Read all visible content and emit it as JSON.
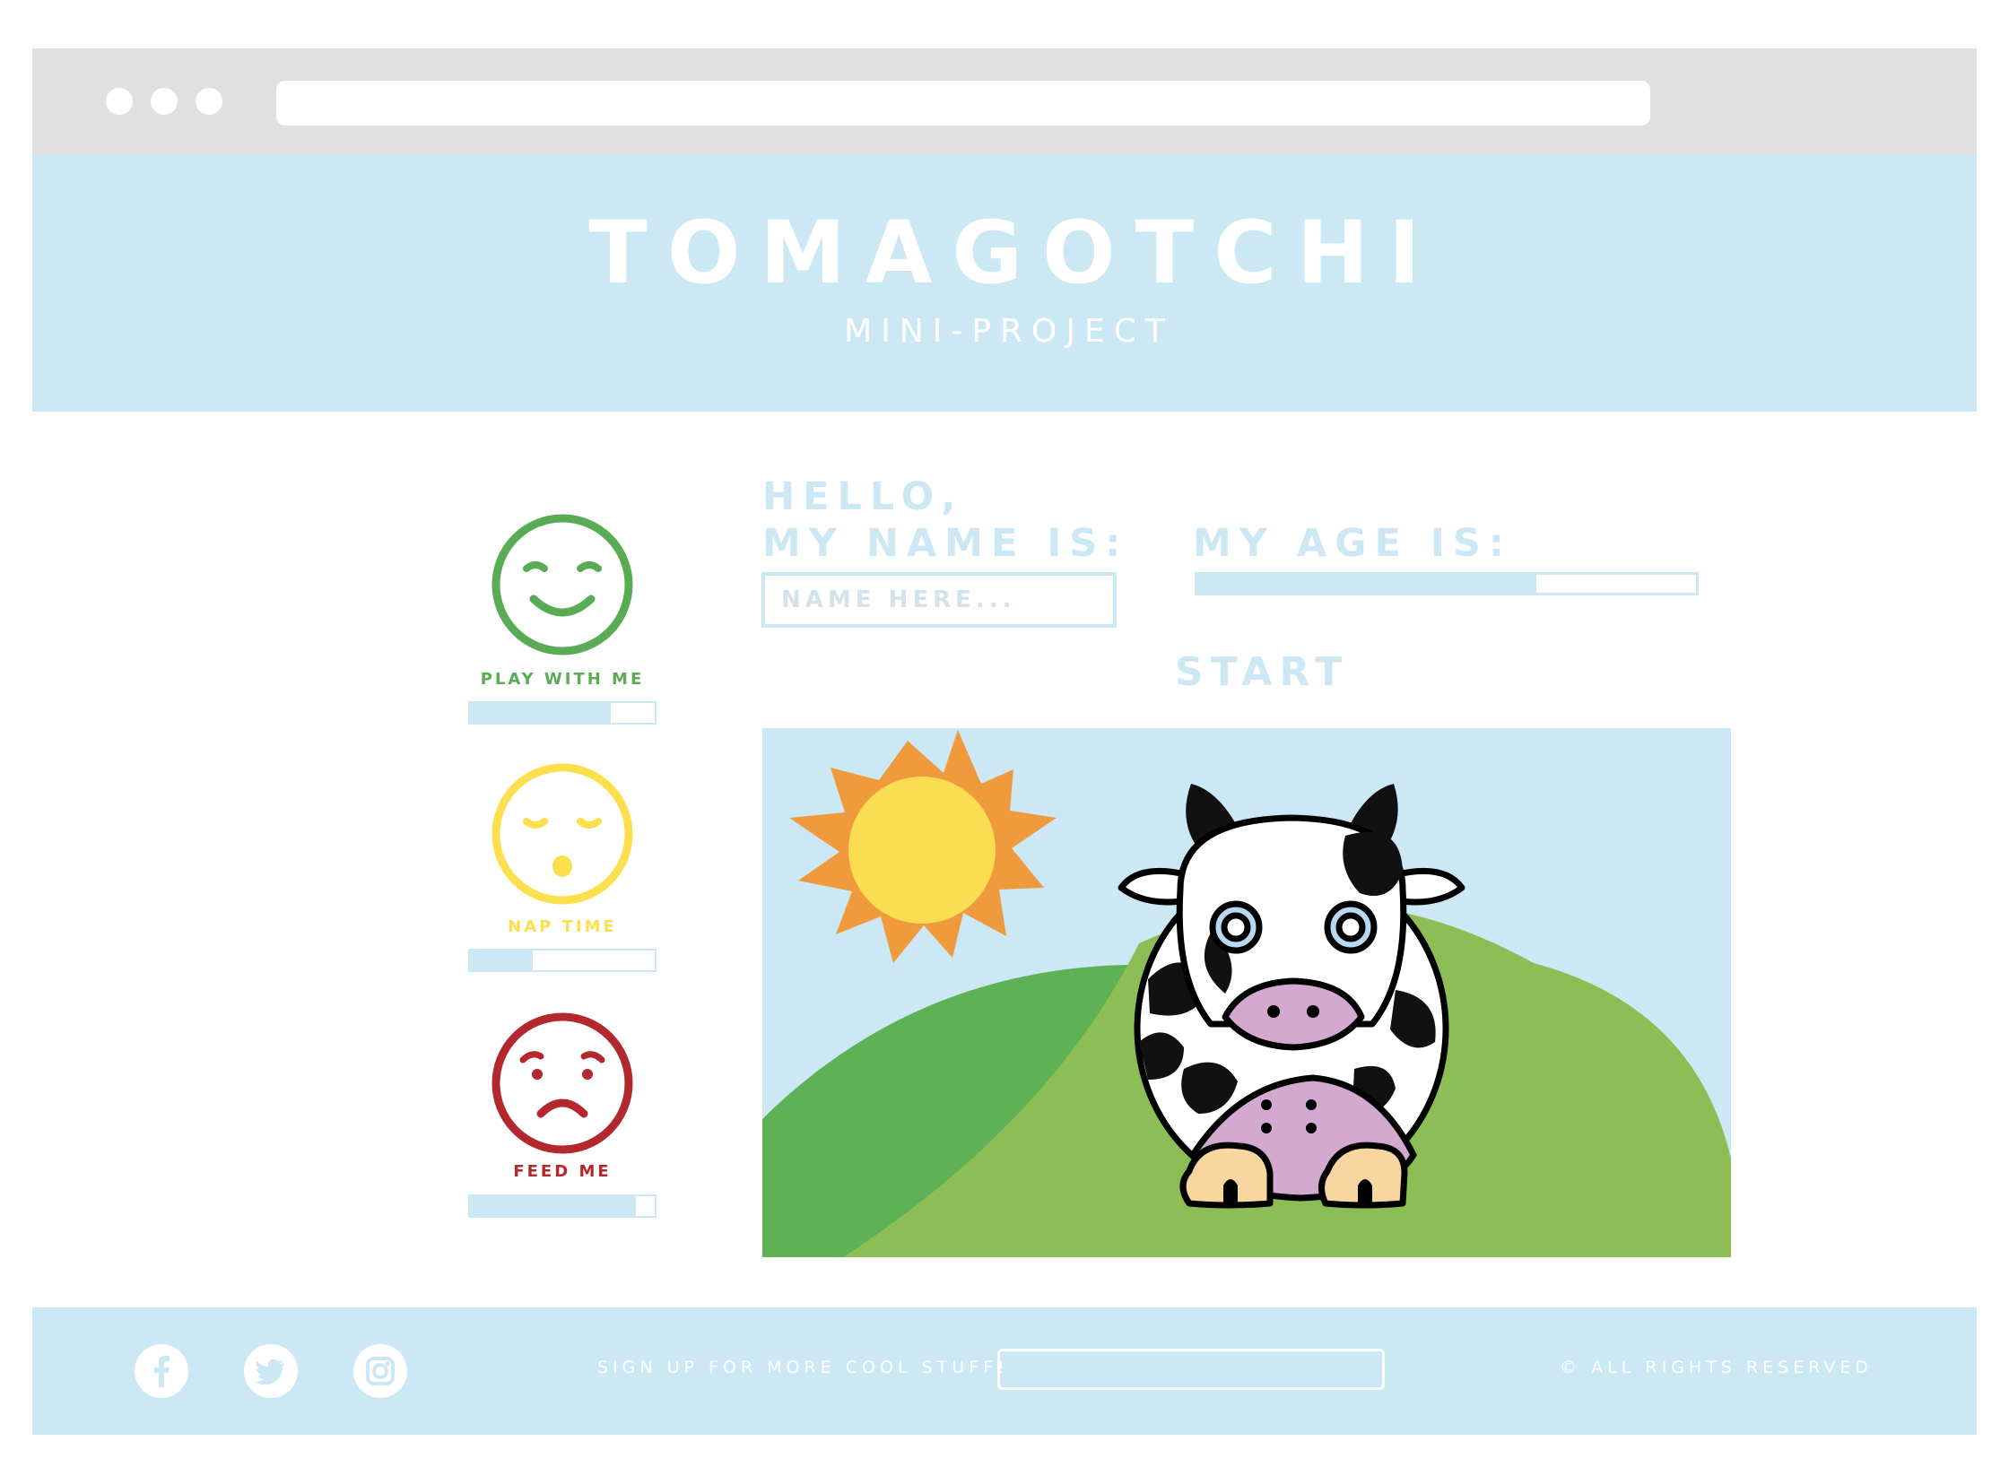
{
  "browser": {
    "url": ""
  },
  "header": {
    "title": "TOMAGOTCHI",
    "subtitle": "MINI-PROJECT"
  },
  "needs": [
    {
      "label": "PLAY WITH ME",
      "mood": "happy",
      "color": "#5aac54",
      "level": 0.76
    },
    {
      "label": "NAP TIME",
      "mood": "sleepy",
      "color": "#fcdf4d",
      "level": 0.34
    },
    {
      "label": "FEED ME",
      "mood": "sad",
      "color": "#b3282d",
      "level": 0.9
    }
  ],
  "profile": {
    "hello_line1": "HELLO,",
    "hello_line2": "MY NAME IS:",
    "name_placeholder": "NAME HERE...",
    "age_label": "MY AGE IS:",
    "age_level": 0.68
  },
  "actions": {
    "start_label": "START"
  },
  "scene": {
    "pet": "cow",
    "icons": [
      "sun-icon",
      "hill-icon",
      "cow-icon"
    ]
  },
  "footer": {
    "social_icons": [
      "facebook-icon",
      "twitter-icon",
      "instagram-icon"
    ],
    "signup_text": "SIGN UP FOR MORE COOL STUFF!",
    "email_placeholder": "",
    "copyright": "© ALL RIGHTS RESERVED"
  },
  "colors": {
    "brand_light_blue": "#cde8f5",
    "chrome_gray": "#e0e0e0",
    "sky": "#cde8f5",
    "hill_dark": "#5fb155",
    "hill_light": "#8dbe55",
    "sun_outer": "#ef9a3c",
    "sun_inner": "#fbdd52",
    "cow_pink": "#d3a9cf",
    "hoof": "#f8d6a0"
  }
}
